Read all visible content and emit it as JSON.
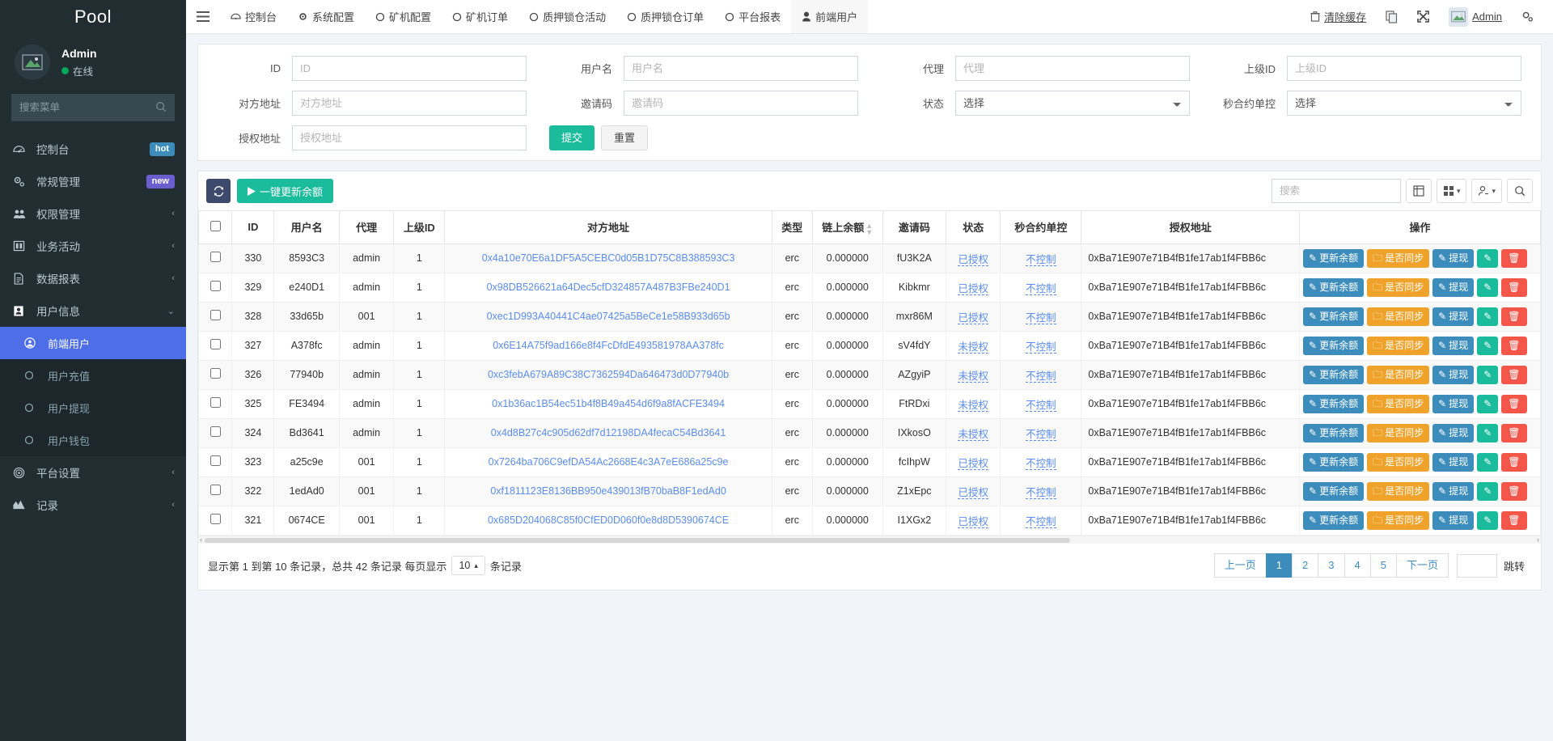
{
  "sidebar": {
    "brand": "Pool",
    "user": {
      "name": "Admin",
      "status": "在线"
    },
    "search_placeholder": "搜索菜单",
    "items": [
      {
        "label": "控制台",
        "icon": "dashboard-icon",
        "badge": "hot",
        "badge_type": "hot"
      },
      {
        "label": "常规管理",
        "icon": "gears-icon",
        "badge": "new",
        "badge_type": "new"
      },
      {
        "label": "权限管理",
        "icon": "users-icon",
        "chevron": "‹"
      },
      {
        "label": "业务活动",
        "icon": "window-icon",
        "chevron": "‹"
      },
      {
        "label": "数据报表",
        "icon": "file-text-icon",
        "chevron": "‹"
      },
      {
        "label": "用户信息",
        "icon": "id-card-icon",
        "chevron": "⌄",
        "active_parent": true
      }
    ],
    "sub_items": [
      {
        "label": "前端用户",
        "icon": "user-circle-icon",
        "active": true
      },
      {
        "label": "用户充值",
        "icon": "circle-o-icon",
        "active": false
      },
      {
        "label": "用户提现",
        "icon": "circle-o-icon",
        "active": false
      },
      {
        "label": "用户钱包",
        "icon": "circle-o-icon",
        "active": false
      }
    ],
    "items_bottom": [
      {
        "label": "平台设置",
        "icon": "target-icon",
        "chevron": "‹"
      },
      {
        "label": "记录",
        "icon": "chart-area-icon",
        "chevron": "‹"
      }
    ]
  },
  "topbar": {
    "menu_icon": "hamburger-icon",
    "tabs": [
      {
        "label": "控制台",
        "icon": "dashboard-icon",
        "active": false
      },
      {
        "label": "系统配置",
        "icon": "gear-icon",
        "active": false
      },
      {
        "label": "矿机配置",
        "icon": "circle-o-icon",
        "active": false
      },
      {
        "label": "矿机订单",
        "icon": "circle-o-icon",
        "active": false
      },
      {
        "label": "质押锁仓活动",
        "icon": "circle-o-icon",
        "active": false
      },
      {
        "label": "质押锁仓订单",
        "icon": "circle-o-icon",
        "active": false
      },
      {
        "label": "平台报表",
        "icon": "circle-o-icon",
        "active": false
      },
      {
        "label": "前端用户",
        "icon": "user-icon",
        "active": true
      }
    ],
    "clear_cache": "清除缓存",
    "copy_icon": "copy-icon",
    "fullscreen_icon": "expand-icon",
    "user_name": "Admin",
    "settings_icon": "gears-icon"
  },
  "filters": {
    "fields": [
      {
        "label": "ID",
        "placeholder": "ID",
        "type": "input",
        "value": ""
      },
      {
        "label": "用户名",
        "placeholder": "用户名",
        "type": "input",
        "value": ""
      },
      {
        "label": "代理",
        "placeholder": "代理",
        "type": "input",
        "value": ""
      },
      {
        "label": "上级ID",
        "placeholder": "上级ID",
        "type": "input",
        "value": ""
      },
      {
        "label": "对方地址",
        "placeholder": "对方地址",
        "type": "input",
        "value": ""
      },
      {
        "label": "邀请码",
        "placeholder": "邀请码",
        "type": "input",
        "value": ""
      },
      {
        "label": "状态",
        "placeholder": "选择",
        "type": "select",
        "value": "选择"
      },
      {
        "label": "秒合约单控",
        "placeholder": "选择",
        "type": "select",
        "value": "选择"
      },
      {
        "label": "授权地址",
        "placeholder": "授权地址",
        "type": "input",
        "value": ""
      }
    ],
    "submit_label": "提交",
    "reset_label": "重置"
  },
  "toolbar": {
    "refresh_icon": "refresh-icon",
    "batch_label": "一键更新余额",
    "batch_icon": "play-icon",
    "search_placeholder": "搜索",
    "columns_icon": "columns-icon",
    "grid_icon": "grid-icon",
    "export_icon": "export-icon",
    "search_icon": "search-icon"
  },
  "table": {
    "columns": [
      "",
      "ID",
      "用户名",
      "代理",
      "上级ID",
      "对方地址",
      "类型",
      "链上余额",
      "邀请码",
      "状态",
      "秒合约单控",
      "授权地址",
      "操作"
    ],
    "sortable_column": "链上余额",
    "rows": [
      {
        "id": "330",
        "username": "8593C3",
        "agent": "admin",
        "parent_id": "1",
        "address": "0x4a10e70E6a1DF5A5CEBC0d05B1D75C8B388593C3",
        "type": "erc",
        "balance": "0.000000",
        "invite": "fU3K2A",
        "status": "已授权",
        "control": "不控制",
        "auth_address": "0xBa71E907e71B4fB1fe17ab1f4FBB6c"
      },
      {
        "id": "329",
        "username": "e240D1",
        "agent": "admin",
        "parent_id": "1",
        "address": "0x98DB526621a64Dec5cfD324857A487B3FBe240D1",
        "type": "erc",
        "balance": "0.000000",
        "invite": "Kibkmr",
        "status": "已授权",
        "control": "不控制",
        "auth_address": "0xBa71E907e71B4fB1fe17ab1f4FBB6c"
      },
      {
        "id": "328",
        "username": "33d65b",
        "agent": "001",
        "parent_id": "1",
        "address": "0xec1D993A40441C4ae07425a5BeCe1e58B933d65b",
        "type": "erc",
        "balance": "0.000000",
        "invite": "mxr86M",
        "status": "已授权",
        "control": "不控制",
        "auth_address": "0xBa71E907e71B4fB1fe17ab1f4FBB6c"
      },
      {
        "id": "327",
        "username": "A378fc",
        "agent": "admin",
        "parent_id": "1",
        "address": "0x6E14A75f9ad166e8f4FcDfdE493581978AA378fc",
        "type": "erc",
        "balance": "0.000000",
        "invite": "sV4fdY",
        "status": "未授权",
        "control": "不控制",
        "auth_address": "0xBa71E907e71B4fB1fe17ab1f4FBB6c"
      },
      {
        "id": "326",
        "username": "77940b",
        "agent": "admin",
        "parent_id": "1",
        "address": "0xc3febA679A89C38C7362594Da646473d0D77940b",
        "type": "erc",
        "balance": "0.000000",
        "invite": "AZgyiP",
        "status": "未授权",
        "control": "不控制",
        "auth_address": "0xBa71E907e71B4fB1fe17ab1f4FBB6c"
      },
      {
        "id": "325",
        "username": "FE3494",
        "agent": "admin",
        "parent_id": "1",
        "address": "0x1b36ac1B54ec51b4f8B49a454d6f9a8fACFE3494",
        "type": "erc",
        "balance": "0.000000",
        "invite": "FtRDxi",
        "status": "未授权",
        "control": "不控制",
        "auth_address": "0xBa71E907e71B4fB1fe17ab1f4FBB6c"
      },
      {
        "id": "324",
        "username": "Bd3641",
        "agent": "admin",
        "parent_id": "1",
        "address": "0x4d8B27c4c905d62df7d12198DA4fecaC54Bd3641",
        "type": "erc",
        "balance": "0.000000",
        "invite": "IXkosO",
        "status": "未授权",
        "control": "不控制",
        "auth_address": "0xBa71E907e71B4fB1fe17ab1f4FBB6c"
      },
      {
        "id": "323",
        "username": "a25c9e",
        "agent": "001",
        "parent_id": "1",
        "address": "0x7264ba706C9efDA54Ac2668E4c3A7eE686a25c9e",
        "type": "erc",
        "balance": "0.000000",
        "invite": "fcIhpW",
        "status": "已授权",
        "control": "不控制",
        "auth_address": "0xBa71E907e71B4fB1fe17ab1f4FBB6c"
      },
      {
        "id": "322",
        "username": "1edAd0",
        "agent": "001",
        "parent_id": "1",
        "address": "0xf1811123E8136BB950e439013fB70baB8F1edAd0",
        "type": "erc",
        "balance": "0.000000",
        "invite": "Z1xEpc",
        "status": "已授权",
        "control": "不控制",
        "auth_address": "0xBa71E907e71B4fB1fe17ab1f4FBB6c"
      },
      {
        "id": "321",
        "username": "0674CE",
        "agent": "001",
        "parent_id": "1",
        "address": "0x685D204068C85f0CfED0D060f0e8d8D5390674CE",
        "type": "erc",
        "balance": "0.000000",
        "invite": "I1XGx2",
        "status": "已授权",
        "control": "不控制",
        "auth_address": "0xBa71E907e71B4fB1fe17ab1f4FBB6c"
      }
    ],
    "ops": {
      "update_balance": "更新余额",
      "sync": "是否同步",
      "withdraw": "提现",
      "edit_icon": "pencil-icon",
      "delete_icon": "trash-icon"
    }
  },
  "footer": {
    "info": "显示第 1 到第 10 条记录，总共 42 条记录 每页显示",
    "page_size": "10",
    "info_suffix": "条记录",
    "prev": "上一页",
    "pages": [
      "1",
      "2",
      "3",
      "4",
      "5"
    ],
    "active_page": "1",
    "next": "下一页",
    "jump": "跳转",
    "jump_value": ""
  },
  "colors": {
    "accent_green": "#1bbc9b",
    "accent_blue": "#3c8dbc",
    "accent_orange": "#f0a32a",
    "accent_red": "#f4564a",
    "sidebar_bg": "#222d32",
    "sidebar_active": "#4d6ee6"
  }
}
